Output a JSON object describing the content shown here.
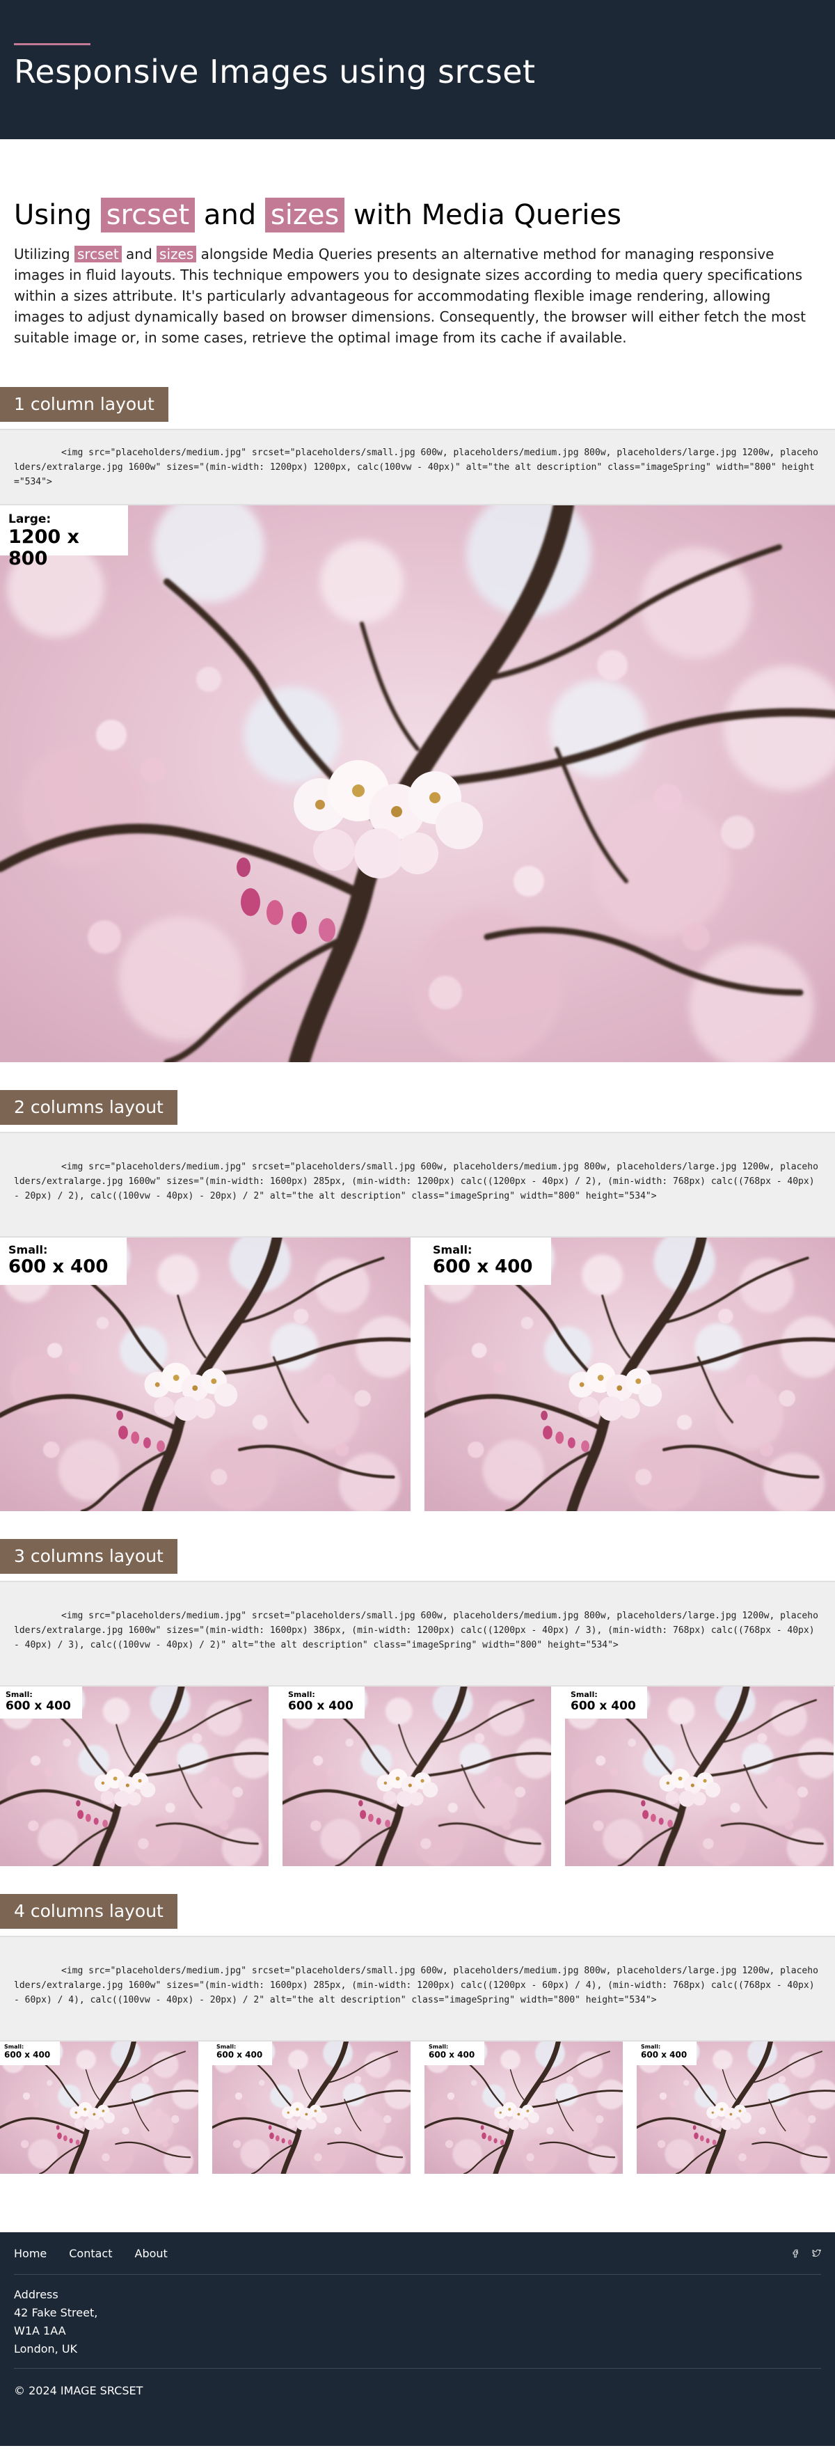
{
  "header": {
    "title": "Responsive Images using srcset"
  },
  "intro": {
    "heading_pre": "Using ",
    "heading_code1": "srcset",
    "heading_mid": " and ",
    "heading_code2": "sizes",
    "heading_post": " with Media Queries",
    "para_pre": "Utilizing ",
    "para_code1": "srcset",
    "para_mid": " and ",
    "para_code2": "sizes",
    "para_post": " alongside Media Queries presents an alternative method for managing responsive images in fluid layouts. This technique empowers you to designate sizes according to media query specifications within a sizes attribute. It's particularly advantageous for accommodating flexible image rendering, allowing images to adjust dynamically based on browser dimensions. Consequently, the browser will either fetch the most suitable image or, in some cases, retrieve the optimal image from its cache if available."
  },
  "sections": [
    {
      "title": "1 column layout",
      "code": "<img src=\"placeholders/medium.jpg\" srcset=\"placeholders/small.jpg 600w, placeholders/medium.jpg 800w, placeholders/large.jpg 1200w, placeholders/extralarge.jpg 1600w\" sizes=\"(min-width: 1200px) 1200px, calc(100vw - 40px)\" alt=\"the alt description\" class=\"imageSpring\" width=\"800\" height=\"534\">",
      "images": [
        {
          "label": "Large:",
          "size": "1200 x 800"
        }
      ]
    },
    {
      "title": "2 columns layout",
      "code": "<img src=\"placeholders/medium.jpg\" srcset=\"placeholders/small.jpg 600w, placeholders/medium.jpg 800w, placeholders/large.jpg 1200w, placeholders/extralarge.jpg 1600w\" sizes=\"(min-width: 1600px) 285px, (min-width: 1200px) calc((1200px - 40px) / 2), (min-width: 768px) calc((768px - 40px) - 20px) / 2), calc((100vw - 40px) - 20px) / 2\" alt=\"the alt description\" class=\"imageSpring\" width=\"800\" height=\"534\">",
      "images": [
        {
          "label": "Small:",
          "size": "600 x 400"
        },
        {
          "label": "Small:",
          "size": "600 x 400"
        }
      ]
    },
    {
      "title": "3 columns layout",
      "code": "<img src=\"placeholders/medium.jpg\" srcset=\"placeholders/small.jpg 600w, placeholders/medium.jpg 800w, placeholders/large.jpg 1200w, placeholders/extralarge.jpg 1600w\" sizes=\"(min-width: 1600px) 386px, (min-width: 1200px) calc((1200px - 40px) / 3), (min-width: 768px) calc((768px - 40px) - 40px) / 3), calc((100vw - 40px) / 2)\" alt=\"the alt description\" class=\"imageSpring\" width=\"800\" height=\"534\">",
      "images": [
        {
          "label": "Small:",
          "size": "600 x 400"
        },
        {
          "label": "Small:",
          "size": "600 x 400"
        },
        {
          "label": "Small:",
          "size": "600 x 400"
        }
      ]
    },
    {
      "title": "4 columns layout",
      "code": "<img src=\"placeholders/medium.jpg\" srcset=\"placeholders/small.jpg 600w, placeholders/medium.jpg 800w, placeholders/large.jpg 1200w, placeholders/extralarge.jpg 1600w\" sizes=\"(min-width: 1600px) 285px, (min-width: 1200px) calc((1200px - 60px) / 4), (min-width: 768px) calc((768px - 40px) - 60px) / 4), calc((100vw - 40px) - 20px) / 2\" alt=\"the alt description\" class=\"imageSpring\" width=\"800\" height=\"534\">",
      "images": [
        {
          "label": "Small:",
          "size": "600 x 400"
        },
        {
          "label": "Small:",
          "size": "600 x 400"
        },
        {
          "label": "Small:",
          "size": "600 x 400"
        },
        {
          "label": "Small:",
          "size": "600 x 400"
        }
      ]
    }
  ],
  "footer": {
    "nav": [
      "Home",
      "Contact",
      "About"
    ],
    "social_icons": [
      "facebook-icon",
      "twitter-icon"
    ],
    "address_title": "Address",
    "address_lines": [
      "42 Fake Street,",
      "W1A 1AA",
      "London, UK"
    ],
    "copyright": "© 2024 IMAGE SRCSET"
  },
  "colors": {
    "header_bg": "#1c2836",
    "accent": "#c27a95",
    "section_label_bg": "#7d6554",
    "code_bg": "#efefef"
  }
}
